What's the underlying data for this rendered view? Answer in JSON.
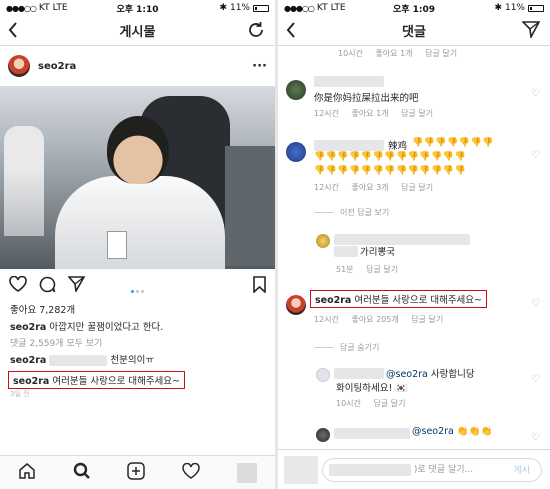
{
  "left": {
    "status": {
      "carrier": "KT",
      "network": "LTE",
      "time": "오후 1:10",
      "battery": "11%"
    },
    "nav": {
      "title": "게시물"
    },
    "post": {
      "username": "seo2ra"
    },
    "likes": "좋아요 7,282개",
    "caption": {
      "user": "seo2ra",
      "text": "아깝지만 꿀잼이었다고 한다."
    },
    "view_all": "댓글 2,559개 모두 보기",
    "comment1": {
      "user": "seo2ra",
      "text": "천분의이ㅠ"
    },
    "comment2": {
      "user": "seo2ra",
      "text": "여러분들 사랑으로 대해주세요~"
    },
    "date": "3일 전"
  },
  "right": {
    "status": {
      "carrier": "KT",
      "network": "LTE",
      "time": "오후 1:09",
      "battery": "11%"
    },
    "nav": {
      "title": "댓글"
    },
    "top_meta": {
      "time": "10시간",
      "likes": "좋아요 1개",
      "reply": "답글 달기"
    },
    "c1": {
      "text": "你是你妈拉屎拉出来的吧",
      "time": "12시간",
      "likes": "좋아요 1개",
      "reply": "답글 달기"
    },
    "c2": {
      "text": "辣鸡",
      "time": "12시간",
      "likes": "좋아요 3개",
      "reply": "답글 달기"
    },
    "prev_replies": "이전 답글 보기",
    "c3": {
      "text": "가리뽕국",
      "time": "51분",
      "reply": "답글 달기"
    },
    "c4": {
      "user": "seo2ra",
      "text": "여러분들 사랑으로 대해주세요~",
      "time": "12시간",
      "likes": "좋아요 205개",
      "reply": "답글 달기"
    },
    "hide_replies": "답글 숨기기",
    "c5": {
      "mention": "@seo2ra",
      "text": "사랑합니당",
      "text2": "화이팅하세요!",
      "time": "10시간",
      "reply": "답글 달기"
    },
    "c6": {
      "mention": "@seo2ra"
    },
    "input": {
      "placeholder": ")로 댓글 달기...",
      "post": "게시"
    }
  },
  "colors": {
    "highlight": "#c4121b",
    "link": "#3897f0",
    "muted": "#999999"
  }
}
